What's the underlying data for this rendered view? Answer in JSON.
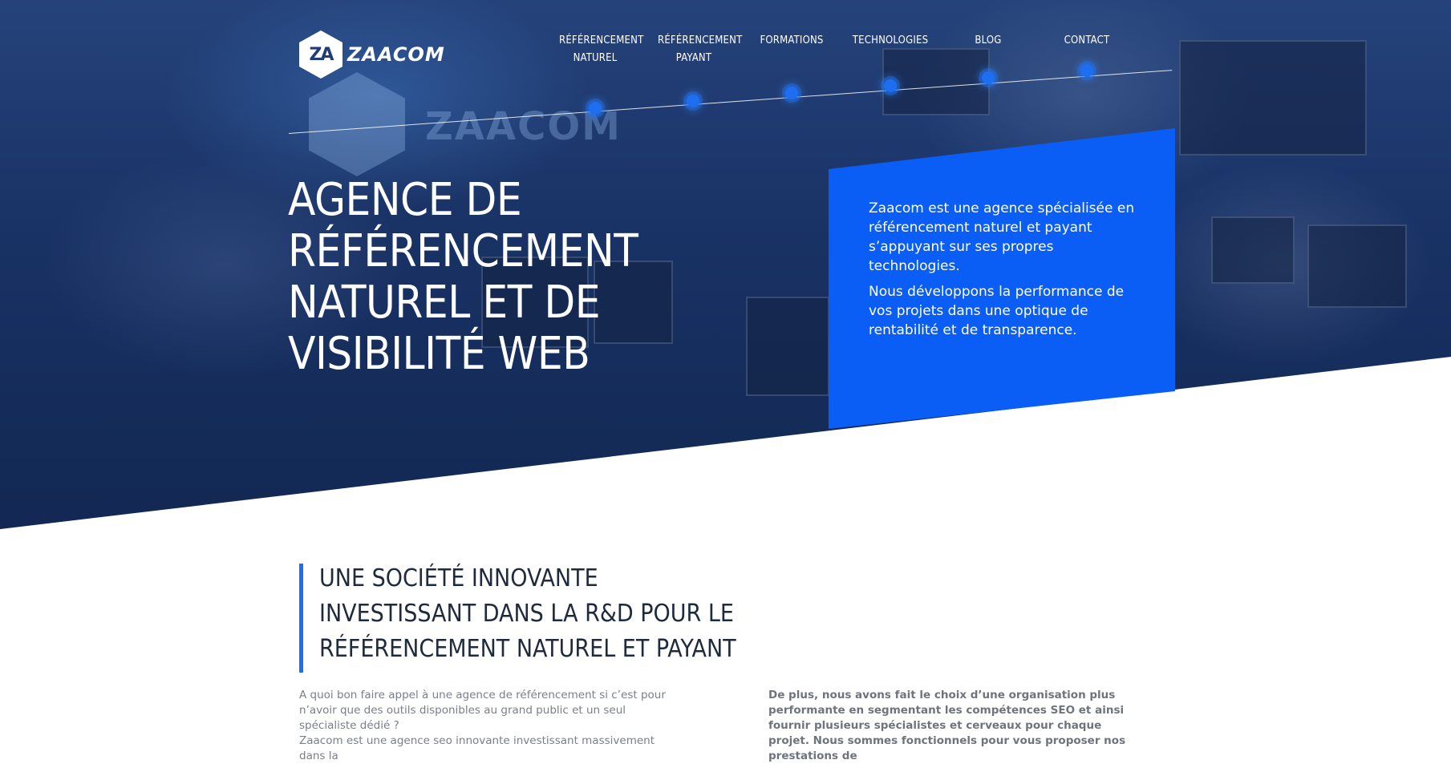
{
  "brand": {
    "logo_mark": "ZA",
    "logo_text": "ZAACOM"
  },
  "nav": [
    {
      "label": "RÉFÉRENCEMENT NATUREL"
    },
    {
      "label": "RÉFÉRENCEMENT PAYANT"
    },
    {
      "label": "FORMATIONS"
    },
    {
      "label": "TECHNOLOGIES"
    },
    {
      "label": "BLOG"
    },
    {
      "label": "CONTACT"
    }
  ],
  "hero": {
    "title": "AGENCE DE RÉFÉRENCEMENT NATUREL ET DE VISIBILITÉ WEB",
    "background_wall_text": "ZAACOM"
  },
  "card": {
    "paragraph1": "Zaacom est une agence spécialisée en référencement naturel et payant s’appuyant sur ses propres technologies.",
    "paragraph2": "Nous développons la performance de vos projets dans une optique de rentabilité et de transparence."
  },
  "section": {
    "title": "UNE SOCIÉTÉ INNOVANTE INVESTISSANT DANS LA R&D POUR LE RÉFÉRENCEMENT NATUREL ET PAYANT",
    "left_text": "A quoi bon faire appel à une agence de référencement si c’est pour n’avoir que des outils disponibles au grand public et un seul spécialiste dédié ?\nZaacom est une agence seo innovante investissant massivement dans la",
    "right_text": "De plus, nous avons fait le choix d’une organisation plus performante en segmentant les compétences SEO et ainsi fournir plusieurs spécialistes et cerveaux pour chaque projet. Nous sommes fonctionnels pour vous proposer nos prestations de"
  },
  "colors": {
    "accent": "#0b5ef5",
    "hero_dark": "#1e3a72",
    "heading": "#1f2b3d"
  }
}
